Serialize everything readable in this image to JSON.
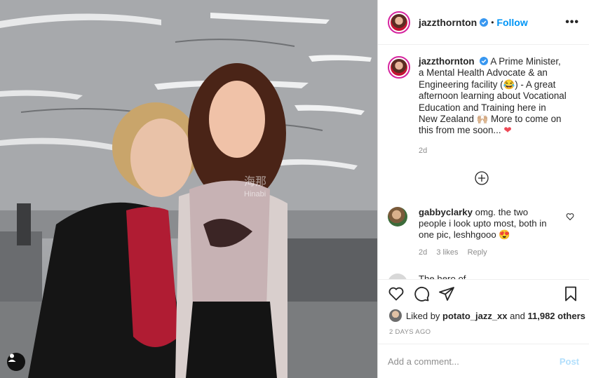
{
  "post": {
    "username": "jazzthornton",
    "follow_label": "Follow",
    "more_label": "•••",
    "separator": "•",
    "caption_user": "jazzthornton",
    "caption_text": "A Prime Minister, a Mental Health Advocate & an Engineering facility (😂) - A great afternoon learning about Vocational Education and Training here in New Zealand 🙌🏼 More to come on this from me soon...",
    "caption_heart": "❤",
    "caption_time": "2d"
  },
  "photo": {
    "watermark_main": "海那",
    "watermark_sub": "Hinabi"
  },
  "comments": [
    {
      "user": "gabbyclarky",
      "text": "omg. the two people i look upto most, both in one pic, leshhgooo 😍",
      "time": "2d",
      "likes": "3 likes",
      "reply": "Reply"
    },
    {
      "user": "",
      "text": "The hero of"
    }
  ],
  "likes": {
    "prefix": "Liked by",
    "user": "potato_jazz_xx",
    "middle": "and",
    "count": "11,982 others"
  },
  "posted_ago": "2 DAYS AGO",
  "add_comment": {
    "placeholder": "Add a comment...",
    "post_label": "Post"
  },
  "colors": {
    "accent": "#0095f6",
    "post_disabled": "#b2dffc",
    "heart": "#ed4956"
  }
}
